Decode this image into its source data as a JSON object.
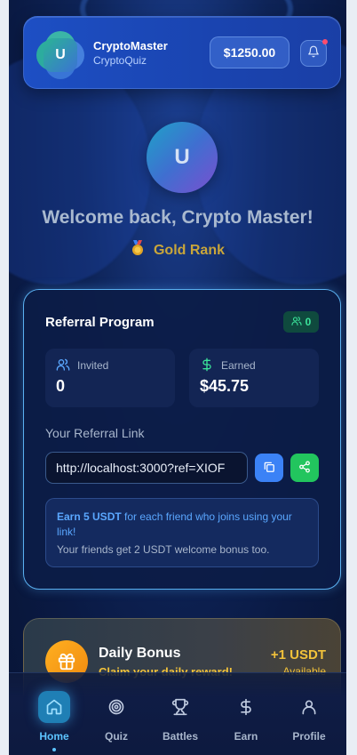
{
  "header": {
    "logo_letter": "U",
    "app_name": "CryptoMaster",
    "app_sub": "CryptoQuiz",
    "balance": "$1250.00"
  },
  "profile": {
    "avatar_letter": "U",
    "welcome": "Welcome back, Crypto Master!",
    "rank": "Gold Rank",
    "rank_icon": "medal-icon"
  },
  "referral": {
    "title": "Referral Program",
    "badge_count": "0",
    "invited_label": "Invited",
    "invited_value": "0",
    "earned_label": "Earned",
    "earned_value": "$45.75",
    "link_label": "Your Referral Link",
    "link_value": "http://localhost:3000?ref=XIOF",
    "info_highlight": "Earn 5 USDT",
    "info_text": " for each friend who joins using your link!",
    "info_sub": "Your friends get 2 USDT welcome bonus too."
  },
  "bonus": {
    "title": "Daily Bonus",
    "subtitle": "Claim your daily reward!",
    "amount": "+1 USDT",
    "status": "Available"
  },
  "nav": {
    "items": [
      {
        "label": "Home",
        "icon": "home-icon",
        "active": true
      },
      {
        "label": "Quiz",
        "icon": "target-icon"
      },
      {
        "label": "Battles",
        "icon": "trophy-icon"
      },
      {
        "label": "Earn",
        "icon": "dollar-icon"
      },
      {
        "label": "Profile",
        "icon": "user-icon"
      }
    ]
  },
  "colors": {
    "accent": "#5cc4ff",
    "gold": "#c9a63a",
    "success": "#22c55e",
    "primary": "#3b82f6"
  }
}
